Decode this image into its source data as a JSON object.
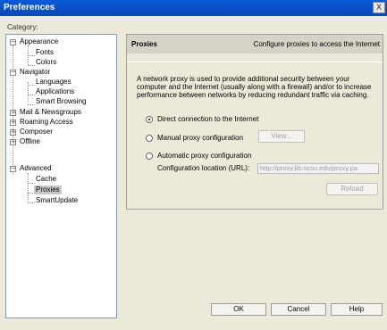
{
  "window": {
    "title": "Preferences",
    "close_label": "X"
  },
  "category_label": "Category:",
  "tree": {
    "items": [
      {
        "label": "Appearance",
        "level": 0,
        "toggle": "−"
      },
      {
        "label": "Fonts",
        "level": 1
      },
      {
        "label": "Colors",
        "level": 1
      },
      {
        "label": "Navigator",
        "level": 0,
        "toggle": "−"
      },
      {
        "label": "Languages",
        "level": 1
      },
      {
        "label": "Applications",
        "level": 1
      },
      {
        "label": "Smart Browsing",
        "level": 1
      },
      {
        "label": "Mail & Newsgroups",
        "level": 0,
        "toggle": "+"
      },
      {
        "label": "Roaming Access",
        "level": 0,
        "toggle": "+"
      },
      {
        "label": "Composer",
        "level": 0,
        "toggle": "+"
      },
      {
        "label": "Offline",
        "level": 0,
        "toggle": "+"
      },
      {
        "label": "Advanced",
        "level": 0,
        "toggle": "−"
      },
      {
        "label": "Cache",
        "level": 1
      },
      {
        "label": "Proxies",
        "level": 1,
        "selected": true
      },
      {
        "label": "SmartUpdate",
        "level": 1
      }
    ]
  },
  "panel": {
    "title": "Proxies",
    "subtitle": "Configure proxies to access the Internet",
    "description": "A network proxy is used to provide additional security between your computer and the Internet (usually along with a firewall) and/or to increase performance between networks by reducing redundant traffic via caching.",
    "options": {
      "direct": "Direct connection to the Internet",
      "manual": "Manual proxy configuration",
      "automatic": "Automatic proxy configuration"
    },
    "selected_option": "direct",
    "view_button": "View...",
    "url_label": "Configuration location (URL):",
    "url_value": "http://proxy.lib.ncsu.edu/proxy.pa",
    "reload_button": "Reload"
  },
  "footer": {
    "ok": "OK",
    "cancel": "Cancel",
    "help": "Help"
  }
}
